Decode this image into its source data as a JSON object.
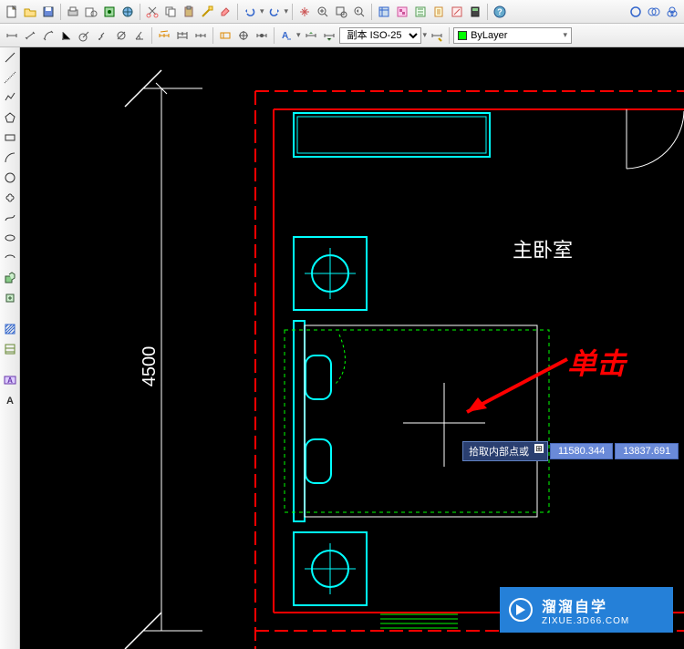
{
  "toolbar2": {
    "style_select": "副本 ISO-25",
    "layer_select": "ByLayer"
  },
  "canvas": {
    "room_label": "主卧室",
    "dimension_v": "4500"
  },
  "prompt": {
    "label": "拾取内部点或",
    "coord1": "11580.344",
    "coord2": "13837.691"
  },
  "annotation": {
    "text": "单击"
  },
  "watermark": {
    "brand_cn": "溜溜自学",
    "brand_url": "ZIXUE.3D66.COM"
  }
}
